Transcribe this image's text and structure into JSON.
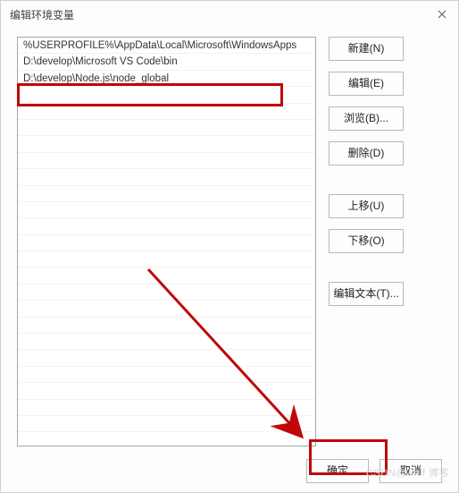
{
  "window": {
    "title": "编辑环境变量"
  },
  "list": {
    "items": [
      "%USERPROFILE%\\AppData\\Local\\Microsoft\\WindowsApps",
      "D:\\develop\\Microsoft VS Code\\bin",
      "D:\\develop\\Node.js\\node_global"
    ],
    "empty_rows": 22
  },
  "buttons": {
    "new": "新建(N)",
    "edit": "编辑(E)",
    "browse": "浏览(B)...",
    "delete": "删除(D)",
    "move_up": "上移(U)",
    "move_down": "下移(O)",
    "edit_text": "编辑文本(T)...",
    "ok": "确定",
    "cancel": "取消"
  },
  "watermark": "CSDN@whif 博客"
}
